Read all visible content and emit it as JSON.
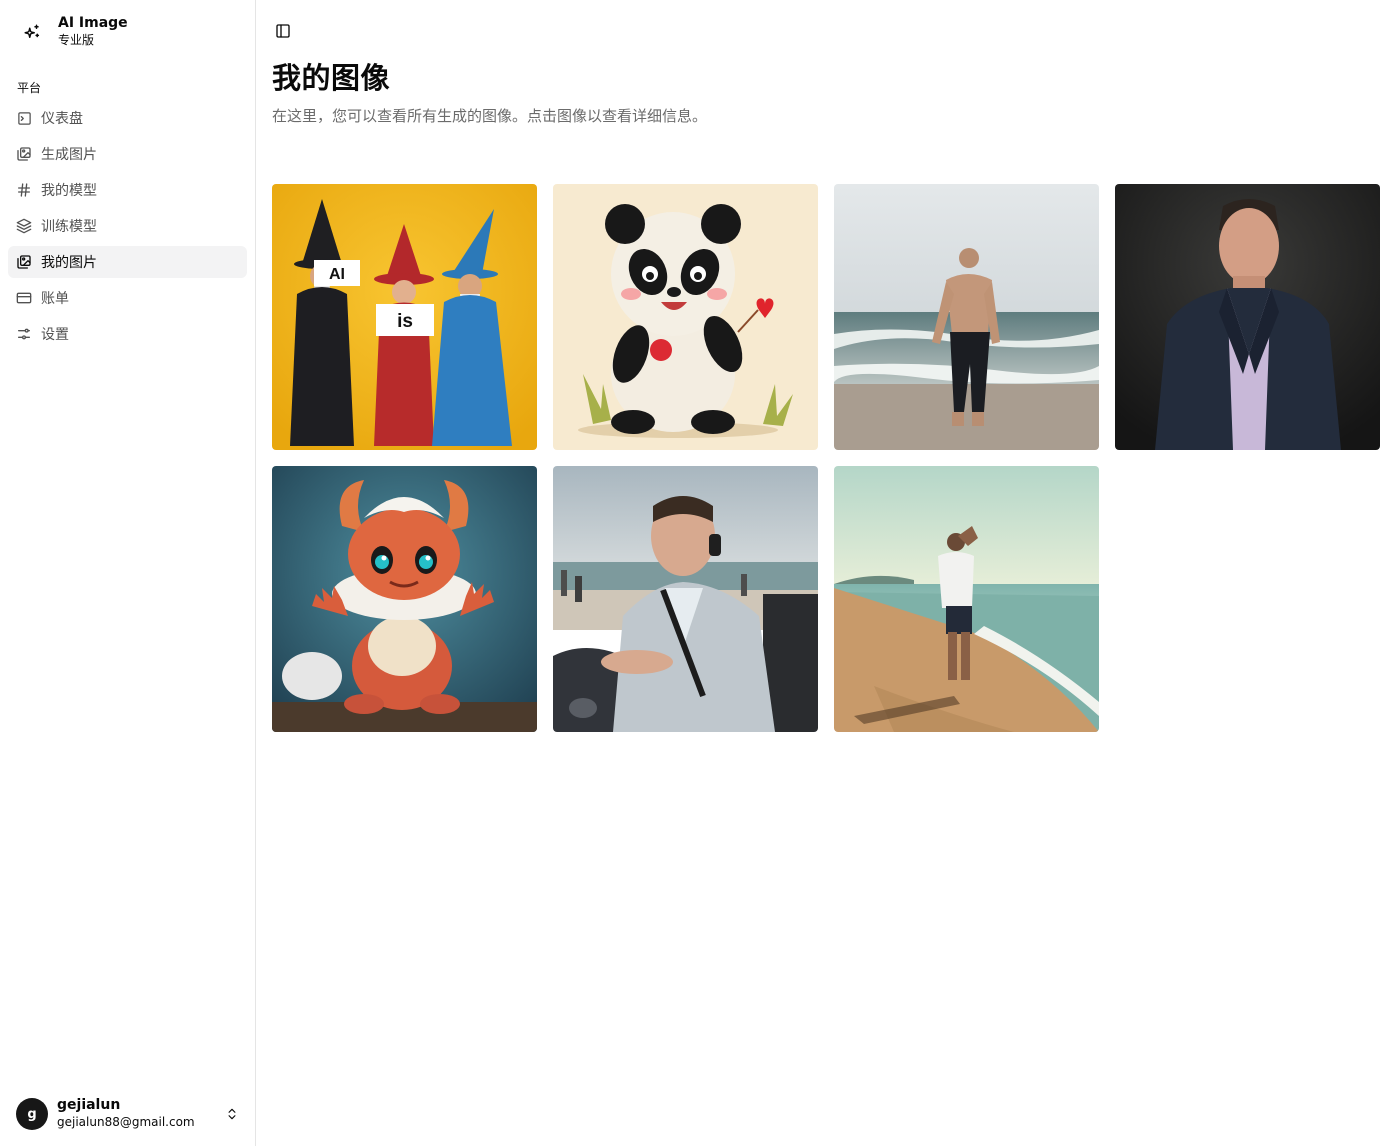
{
  "brand": {
    "name": "AI Image",
    "plan": "专业版",
    "icon": "sparkles-icon"
  },
  "sidebar": {
    "group_label": "平台",
    "items": [
      {
        "label": "仪表盘",
        "icon": "terminal-icon",
        "active": false
      },
      {
        "label": "生成图片",
        "icon": "images-icon",
        "active": false
      },
      {
        "label": "我的模型",
        "icon": "hash-icon",
        "active": false
      },
      {
        "label": "训练模型",
        "icon": "layers-icon",
        "active": false
      },
      {
        "label": "我的图片",
        "icon": "images-icon",
        "active": true
      },
      {
        "label": "账单",
        "icon": "credit-card-icon",
        "active": false
      },
      {
        "label": "设置",
        "icon": "sliders-icon",
        "active": false
      }
    ]
  },
  "user": {
    "initial": "g",
    "name": "gejialun",
    "email": "gejialun88@gmail.com"
  },
  "main": {
    "title": "我的图像",
    "subtitle": "在这里，您可以查看所有生成的图像。点击图像以查看详细信息。"
  },
  "gallery": {
    "images": [
      {
        "subject": "three-wizards",
        "caption_signs": [
          "AI",
          "is"
        ]
      },
      {
        "subject": "cartoon-panda"
      },
      {
        "subject": "man-on-beach-shirtless"
      },
      {
        "subject": "man-in-suit-portrait"
      },
      {
        "subject": "orange-dragon-creature"
      },
      {
        "subject": "man-driving-convertible"
      },
      {
        "subject": "man-walking-beach"
      }
    ]
  }
}
